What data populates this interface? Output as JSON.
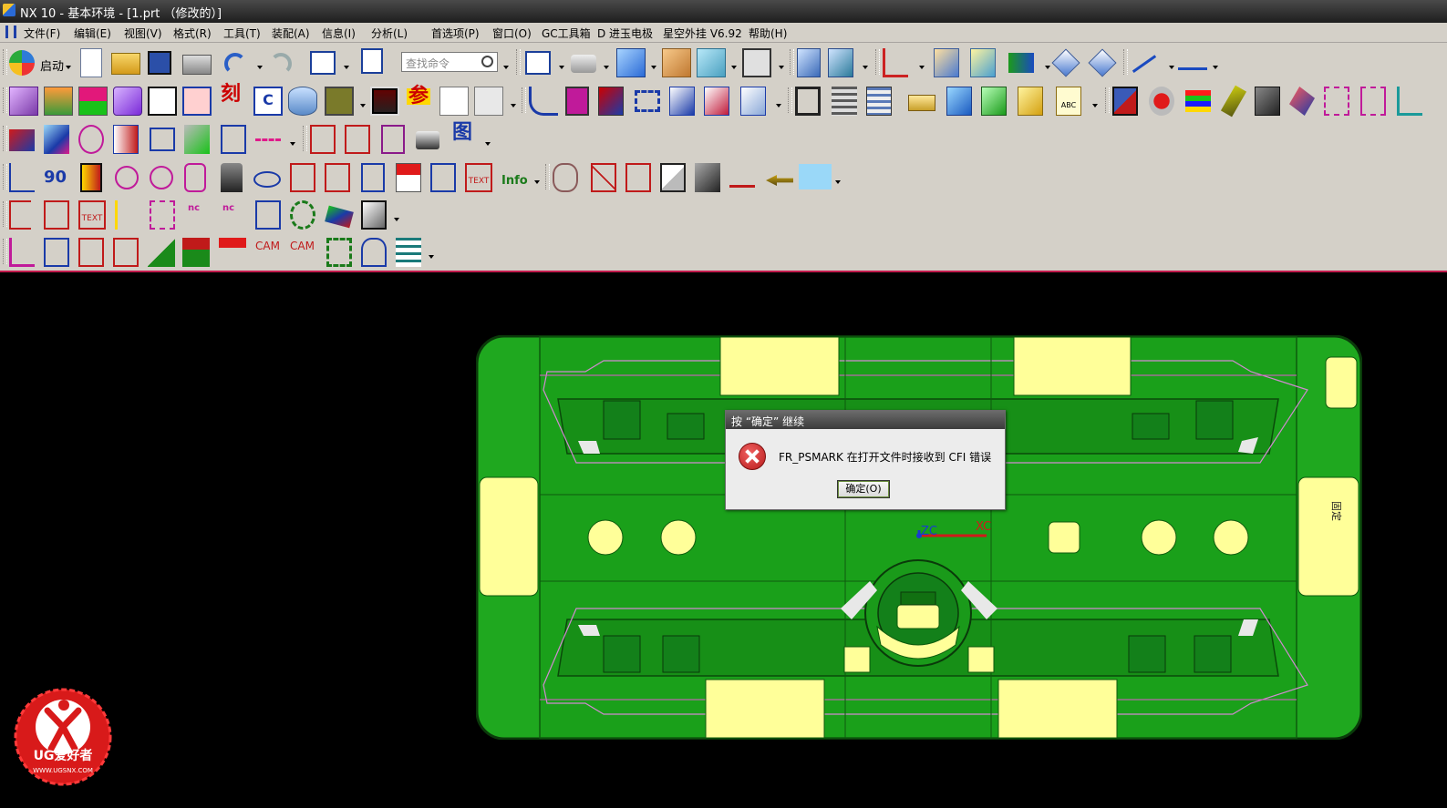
{
  "window": {
    "title": "NX 10 - 基本环境 - [1.prt （修改的）]"
  },
  "menubar": {
    "items": [
      {
        "label": "文件(F)"
      },
      {
        "label": "编辑(E)"
      },
      {
        "label": "视图(V)"
      },
      {
        "label": "格式(R)"
      },
      {
        "label": "工具(T)"
      },
      {
        "label": "装配(A)"
      },
      {
        "label": "信息(I)"
      },
      {
        "label": "分析(L)"
      },
      {
        "label": "首选项(P)"
      },
      {
        "label": "窗口(O)"
      },
      {
        "label": "GC工具箱"
      },
      {
        "label": "D 进玉电极"
      },
      {
        "label": "星空外挂 V6.92"
      },
      {
        "label": "帮助(H)"
      }
    ]
  },
  "toolbar": {
    "start_label": "启动",
    "search_placeholder": "查找命令",
    "text_icons": {
      "engrave": "刻",
      "param": "参",
      "drawing": "图",
      "angle": "90",
      "info": "Info",
      "cam1": "CAM",
      "cam2": "CAM",
      "text1": "TEXT",
      "text2": "TEXT",
      "nc1": "nc",
      "nc2": "nc",
      "abc": "ABC",
      "c_label": "C"
    }
  },
  "viewport": {
    "background": "#000000",
    "part_color": "#1fa81f",
    "pad_color": "#ffff99",
    "axis_labels": {
      "zc": "ZC",
      "xc": "XC"
    },
    "side_label": "固定"
  },
  "dialog": {
    "title": "按 “确定” 继续",
    "message": "FR_PSMARK 在打开文件时接收到 CFI 错误",
    "ok_label": "确定(O)"
  },
  "watermark": {
    "brand": "UG爱好者",
    "url": "WWW.UGSNX.COM"
  }
}
